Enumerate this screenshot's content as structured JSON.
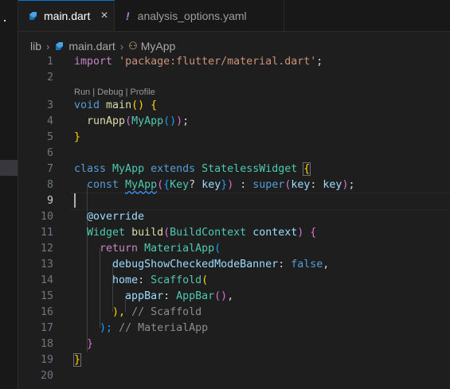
{
  "tabs": [
    {
      "label": "main.dart",
      "close": "×",
      "active": true
    },
    {
      "label": "analysis_options.yaml",
      "icon_glyph": "!",
      "active": false
    }
  ],
  "breadcrumb": {
    "folder": "lib",
    "file": "main.dart",
    "symbol_icon": "⚇",
    "symbol": "MyApp"
  },
  "codelens": "Run | Debug | Profile",
  "line_numbers": [
    "1",
    "2",
    "3",
    "4",
    "5",
    "6",
    "7",
    "8",
    "9",
    "10",
    "11",
    "12",
    "13",
    "14",
    "15",
    "16",
    "17",
    "18",
    "19",
    "20"
  ],
  "code": {
    "l1": [
      "import",
      "'package:flutter/material.dart'",
      ";"
    ],
    "l3": [
      "void",
      "main",
      "()",
      " {"
    ],
    "l4": [
      "runApp",
      "(",
      "MyApp",
      "()",
      ")",
      ";"
    ],
    "l5": [
      "}"
    ],
    "l7": [
      "class",
      "MyApp",
      "extends",
      "StatelessWidget",
      "{"
    ],
    "l8": [
      "const",
      "MyApp",
      "(",
      "{",
      "Key",
      "?",
      "key",
      "}",
      ")",
      ":",
      "super",
      "(",
      "key",
      ":",
      "key",
      ")",
      ";"
    ],
    "l10": [
      "@override"
    ],
    "l11": [
      "Widget",
      "build",
      "(",
      "BuildContext",
      "context",
      ")",
      "{"
    ],
    "l12": [
      "return",
      "MaterialApp",
      "("
    ],
    "l13": [
      "debugShowCheckedModeBanner",
      ":",
      "false",
      ","
    ],
    "l14": [
      "home",
      ":",
      "Scaffold",
      "("
    ],
    "l15": [
      "appBar",
      ":",
      "AppBar",
      "()",
      ","
    ],
    "l16": [
      "),",
      "// Scaffold"
    ],
    "l17": [
      ");",
      "// MaterialApp"
    ],
    "l18": [
      "}"
    ],
    "l19": [
      "}"
    ]
  },
  "colors": {
    "accent": "#0078d4",
    "background": "#1e1e1e",
    "keyword": "#569cd6",
    "type": "#4ec9b0",
    "function": "#dcdcaa",
    "string": "#ce9178"
  },
  "icons": {
    "dart": "dart-file-icon",
    "yaml": "yaml-warning-icon",
    "symbol": "class-symbol-icon"
  }
}
